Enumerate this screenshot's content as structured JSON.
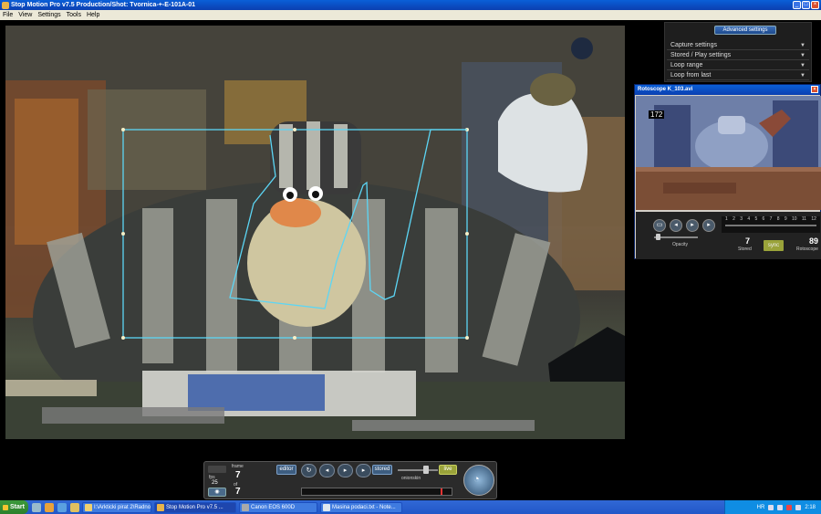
{
  "window": {
    "title": "Stop Motion Pro v7.5   Production/Shot: Tvornica-+-E-101A-01"
  },
  "menu": [
    {
      "label": "File"
    },
    {
      "label": "View"
    },
    {
      "label": "Settings"
    },
    {
      "label": "Tools"
    },
    {
      "label": "Help"
    }
  ],
  "right_panel": {
    "advanced_label": "Advanced settings",
    "items": [
      {
        "label": "Capture settings"
      },
      {
        "label": "Stored / Play settings"
      },
      {
        "label": "Loop range"
      },
      {
        "label": "Loop from last"
      }
    ]
  },
  "rotoscope": {
    "title": "Rotoscope  K_103.avi",
    "frame_number": "172",
    "timeline_ticks": [
      "1",
      "2",
      "3",
      "4",
      "5",
      "6",
      "7",
      "8",
      "9",
      "10",
      "11",
      "12"
    ],
    "opacity_label": "Opacity",
    "stored_value": "7",
    "stored_label": "Stored",
    "sync_label": "sync",
    "rotoscope_value": "89",
    "rotoscope_label": "Rotoscope"
  },
  "controls": {
    "fps_label": "fps",
    "fps_value": "25",
    "frame_label": "frame",
    "frame_value": "7",
    "of_label": "of",
    "total_value": "7",
    "editor_label": "editor",
    "stored_label": "stored",
    "onionskin_label": "onionskin",
    "live_label": "live"
  },
  "taskbar": {
    "start_label": "Start",
    "tasks": [
      {
        "label": "I:\\Arkticki pirat 2\\Radno"
      },
      {
        "label": "Stop Motion Pro v7.5 ..."
      },
      {
        "label": "Canon EOS 600D"
      },
      {
        "label": "Masina podaci.txt - Note..."
      }
    ],
    "language": "HR",
    "clock": "2:18"
  },
  "colors": {
    "selection_outline": "#5cd6f5",
    "live_button": "#9aa33a",
    "titlebar": "#0b3fb0"
  }
}
